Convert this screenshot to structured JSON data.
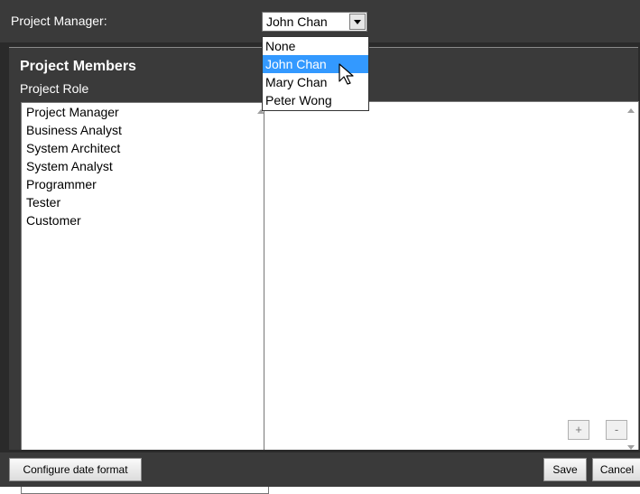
{
  "header": {
    "project_manager_label": "Project Manager:",
    "selected_manager": "John Chan"
  },
  "dropdown": {
    "options": [
      "None",
      "John Chan",
      "Mary Chan",
      "Peter Wong"
    ],
    "highlighted": "John Chan"
  },
  "panel": {
    "title": "Project Members",
    "role_label": "Project Role",
    "roles": [
      "Project Manager",
      "Business Analyst",
      "System Architect",
      "System Analyst",
      "Programmer",
      "Tester",
      "Customer"
    ],
    "add_label": "+",
    "remove_label": "-"
  },
  "footer": {
    "configure_label": "Configure date format",
    "save_label": "Save",
    "cancel_label": "Cancel"
  },
  "colors": {
    "background_dark": "#3a3a3a",
    "selection_blue": "#3399ff"
  }
}
